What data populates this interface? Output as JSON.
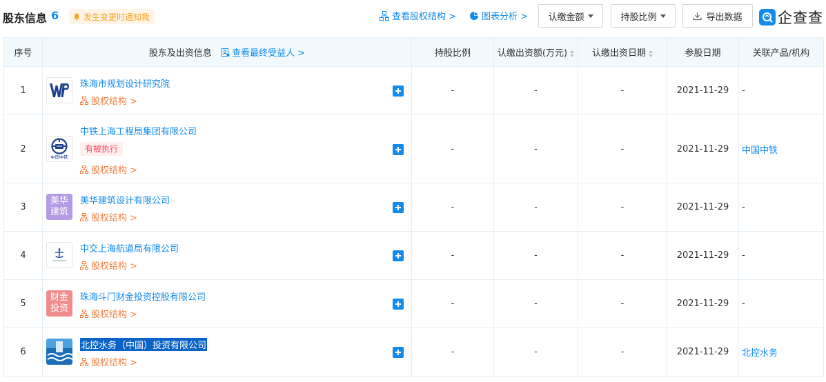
{
  "header": {
    "title": "股东信息",
    "count": "6",
    "notice": "发生变更时通知我",
    "link_structure": "查看股权结构 >",
    "link_chart": "图表分析 >",
    "btn_amount": "认缴金额",
    "btn_ratio": "持股比例",
    "btn_export": "导出数据",
    "logo_text": "企查查"
  },
  "columns": {
    "index": "序号",
    "info": "股东及出资信息",
    "beneficiary_link": "查看最终受益人 >",
    "ratio": "持股比例",
    "amount": "认缴出资额(万元)",
    "date": "认缴出资日期",
    "join_date": "参股日期",
    "related": "关联产品/机构"
  },
  "rows": [
    {
      "index": "1",
      "name": "珠海市规划设计研究院",
      "equity": "股权结构 >",
      "tag": "",
      "ratio": "-",
      "amount": "-",
      "date": "-",
      "join_date": "2021-11-29",
      "related": "-"
    },
    {
      "index": "2",
      "name": "中铁上海工程局集团有限公司",
      "equity": "股权结构 >",
      "tag": "有被执行",
      "logo_caption": "中国中铁",
      "ratio": "-",
      "amount": "-",
      "date": "-",
      "join_date": "2021-11-29",
      "related": "中国中铁"
    },
    {
      "index": "3",
      "name": "美华建筑设计有限公司",
      "equity": "股权结构 >",
      "tag": "",
      "logo_text_1": "美华",
      "logo_text_2": "建筑",
      "ratio": "-",
      "amount": "-",
      "date": "-",
      "join_date": "2021-11-29",
      "related": "-"
    },
    {
      "index": "4",
      "name": "中交上海航道局有限公司",
      "equity": "股权结构 >",
      "tag": "",
      "ratio": "-",
      "amount": "-",
      "date": "-",
      "join_date": "2021-11-29",
      "related": "-"
    },
    {
      "index": "5",
      "name": "珠海斗门财金投资控股有限公司",
      "equity": "股权结构 >",
      "tag": "",
      "logo_text_1": "财金",
      "logo_text_2": "投资",
      "ratio": "-",
      "amount": "-",
      "date": "-",
      "join_date": "2021-11-29",
      "related": "-"
    },
    {
      "index": "6",
      "name": "北控水务（中国）投资有限公司",
      "equity": "股权结构 >",
      "tag": "",
      "ratio": "-",
      "amount": "-",
      "date": "-",
      "join_date": "2021-11-29",
      "related": "北控水务"
    }
  ],
  "colors": {
    "accent": "#128bed",
    "equity_orange": "#f17f42",
    "tag_red": "#fd485e",
    "header_bg": "#f2f9fc",
    "logo_meihua": "#b49be6",
    "logo_caijin": "#f08c8c",
    "selection": "#0a64c8"
  }
}
